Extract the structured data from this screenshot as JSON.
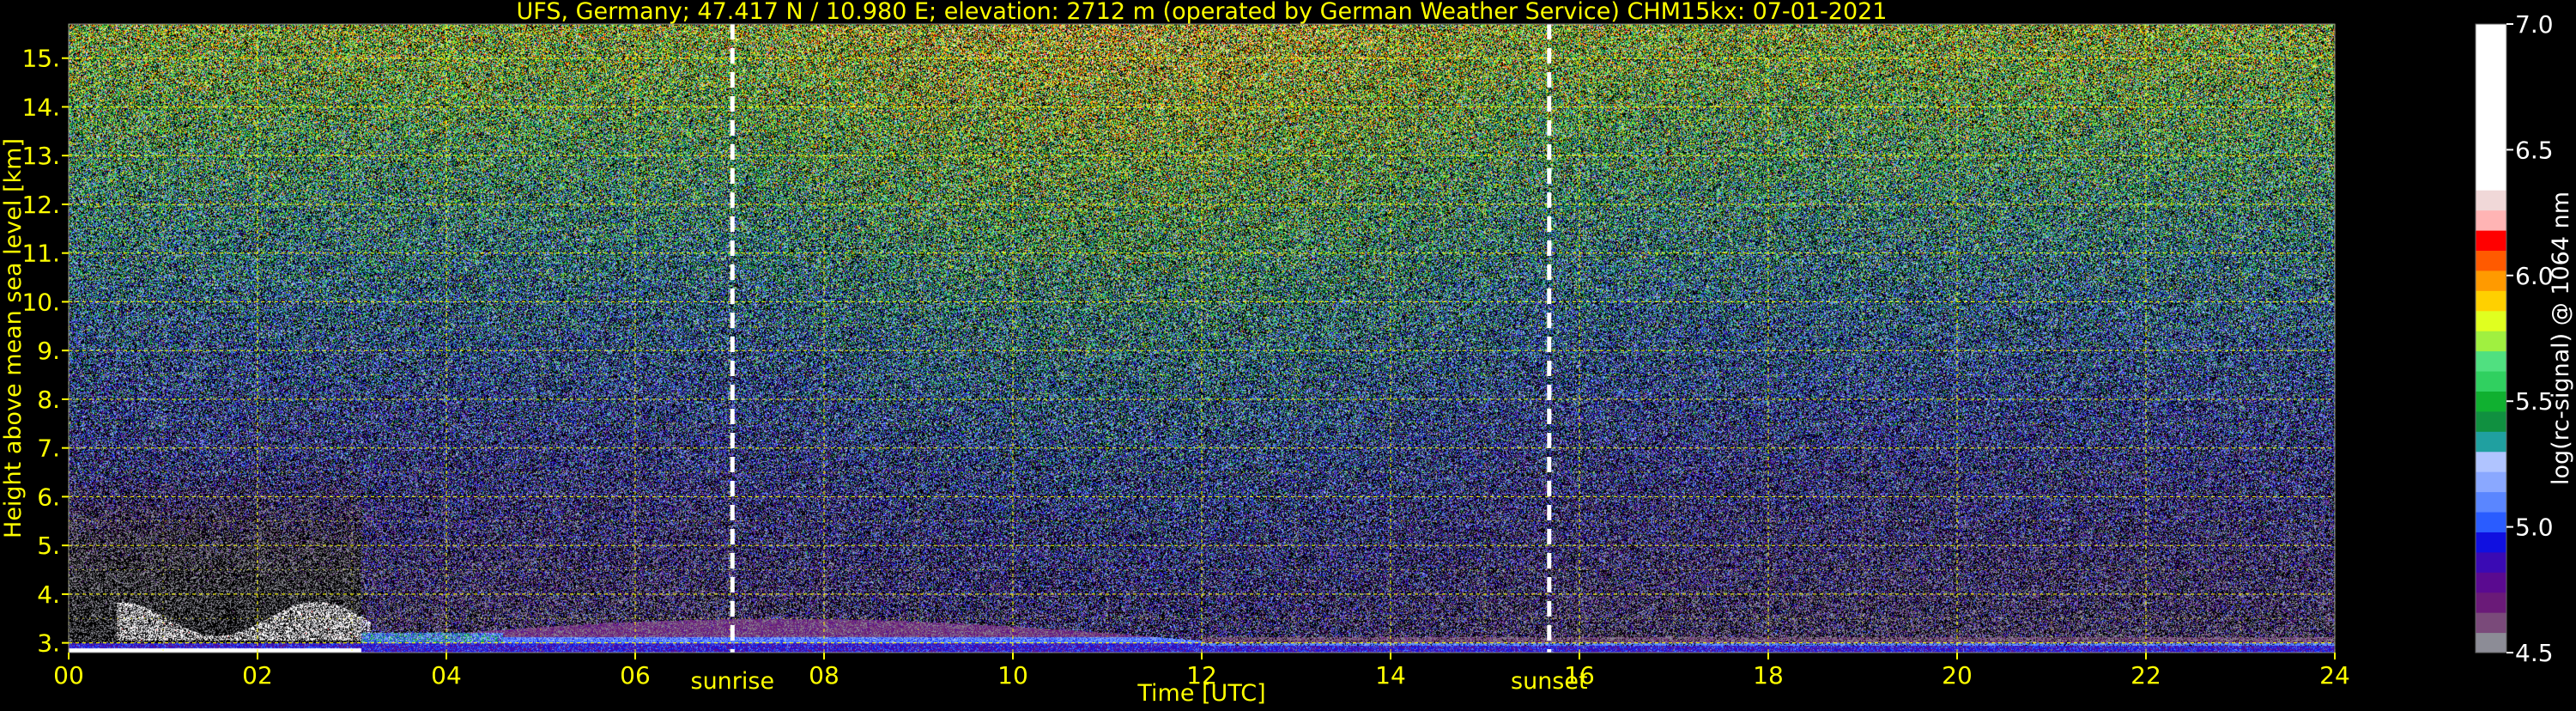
{
  "chart_data": {
    "type": "heatmap",
    "title": "UFS, Germany; 47.417 N / 10.980 E; elevation: 2712 m  (operated by German Weather Service)    CHM15kx: 07-01-2021",
    "xlabel": "Time [UTC]",
    "ylabel": "Height above mean sea level [km]",
    "colorbar_label": "log(rc-signal) @ 1064 nm",
    "xlim": [
      0,
      24
    ],
    "ylim": [
      2.8,
      15.7
    ],
    "x_ticks": [
      {
        "value": 0,
        "label": "00"
      },
      {
        "value": 2,
        "label": "02"
      },
      {
        "value": 4,
        "label": "04"
      },
      {
        "value": 6,
        "label": "06"
      },
      {
        "value": 8,
        "label": "08"
      },
      {
        "value": 10,
        "label": "10"
      },
      {
        "value": 12,
        "label": "12"
      },
      {
        "value": 14,
        "label": "14"
      },
      {
        "value": 16,
        "label": "16"
      },
      {
        "value": 18,
        "label": "18"
      },
      {
        "value": 20,
        "label": "20"
      },
      {
        "value": 22,
        "label": "22"
      },
      {
        "value": 24,
        "label": "24"
      }
    ],
    "y_ticks": [
      {
        "value": 3,
        "label": "3."
      },
      {
        "value": 4,
        "label": "4."
      },
      {
        "value": 5,
        "label": "5."
      },
      {
        "value": 6,
        "label": "6."
      },
      {
        "value": 7,
        "label": "7."
      },
      {
        "value": 8,
        "label": "8."
      },
      {
        "value": 9,
        "label": "9."
      },
      {
        "value": 10,
        "label": "10."
      },
      {
        "value": 11,
        "label": "11."
      },
      {
        "value": 12,
        "label": "12."
      },
      {
        "value": 13,
        "label": "13."
      },
      {
        "value": 14,
        "label": "14."
      },
      {
        "value": 15,
        "label": "15."
      }
    ],
    "x_minor_grid": [
      1,
      3,
      5,
      7,
      9,
      11,
      13,
      15,
      17,
      19,
      21,
      23
    ],
    "y_minor_grid": [
      3.5,
      4.5,
      5.5,
      6.5,
      7.5,
      8.5,
      9.5,
      10.5,
      11.5,
      12.5,
      13.5,
      14.5,
      15.5
    ],
    "grid": true,
    "grid_color": "#ffff00",
    "text_color": "#ffff00",
    "background": "#000000",
    "events": [
      {
        "label": "sunrise",
        "time": 7.03
      },
      {
        "label": "sunset",
        "time": 15.68
      }
    ],
    "colorbar": {
      "range": [
        4.5,
        7.0
      ],
      "ticks": [
        {
          "value": 4.5,
          "label": "4.5"
        },
        {
          "value": 5.0,
          "label": "5.0"
        },
        {
          "value": 5.5,
          "label": "5.5"
        },
        {
          "value": 6.0,
          "label": "6.0"
        },
        {
          "value": 6.5,
          "label": "6.5"
        },
        {
          "value": 7.0,
          "label": "7.0"
        }
      ],
      "colors": [
        {
          "from": 4.5,
          "to": 4.58,
          "color": "#8c8c96"
        },
        {
          "from": 4.58,
          "to": 4.66,
          "color": "#7a4a7a"
        },
        {
          "from": 4.66,
          "to": 4.74,
          "color": "#6a1a78"
        },
        {
          "from": 4.74,
          "to": 4.82,
          "color": "#5a0a90"
        },
        {
          "from": 4.82,
          "to": 4.9,
          "color": "#3a0ab4"
        },
        {
          "from": 4.9,
          "to": 4.98,
          "color": "#1010e0"
        },
        {
          "from": 4.98,
          "to": 5.06,
          "color": "#2a5cff"
        },
        {
          "from": 5.06,
          "to": 5.14,
          "color": "#5a86ff"
        },
        {
          "from": 5.14,
          "to": 5.22,
          "color": "#8aa8ff"
        },
        {
          "from": 5.22,
          "to": 5.3,
          "color": "#b0c4ff"
        },
        {
          "from": 5.3,
          "to": 5.38,
          "color": "#20a0a0"
        },
        {
          "from": 5.38,
          "to": 5.46,
          "color": "#109040"
        },
        {
          "from": 5.46,
          "to": 5.54,
          "color": "#10b030"
        },
        {
          "from": 5.54,
          "to": 5.62,
          "color": "#30d060"
        },
        {
          "from": 5.62,
          "to": 5.7,
          "color": "#50e080"
        },
        {
          "from": 5.7,
          "to": 5.78,
          "color": "#a0f040"
        },
        {
          "from": 5.78,
          "to": 5.86,
          "color": "#e0ff20"
        },
        {
          "from": 5.86,
          "to": 5.94,
          "color": "#ffd000"
        },
        {
          "from": 5.94,
          "to": 6.02,
          "color": "#ff9a00"
        },
        {
          "from": 6.02,
          "to": 6.1,
          "color": "#ff5a00"
        },
        {
          "from": 6.1,
          "to": 6.18,
          "color": "#ff0000"
        },
        {
          "from": 6.18,
          "to": 6.26,
          "color": "#ffb4b4"
        },
        {
          "from": 6.26,
          "to": 6.34,
          "color": "#f0d8d8"
        },
        {
          "from": 6.34,
          "to": 7.0,
          "color": "#ffffff"
        }
      ]
    },
    "features": [
      {
        "name": "surface-noise-layer",
        "x": [
          0,
          24
        ],
        "y": [
          2.85,
          3.0
        ]
      },
      {
        "name": "night-aerosol-layer",
        "x": [
          3.1,
          12.0
        ],
        "y": [
          3.0,
          3.5
        ]
      },
      {
        "name": "early-morning-cloud",
        "x": [
          0.5,
          3.2
        ],
        "y": [
          3.0,
          3.9
        ]
      },
      {
        "name": "afternoon-residual-layer",
        "x": [
          12.0,
          24
        ],
        "y": [
          2.95,
          3.2
        ]
      }
    ]
  }
}
